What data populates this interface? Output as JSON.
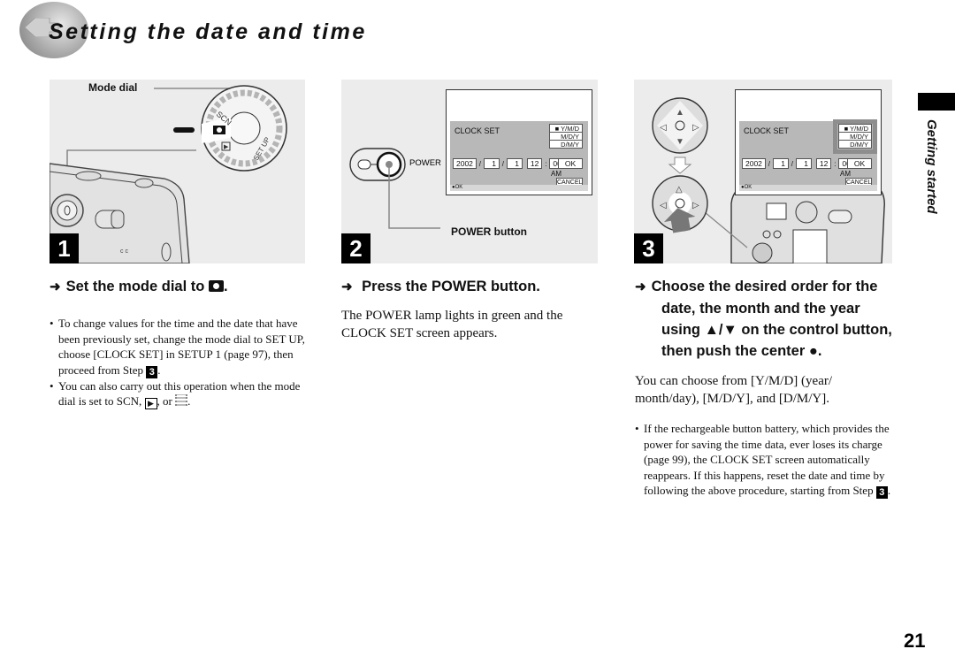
{
  "page": {
    "title": "Setting the date and time",
    "side_tab_label": "Getting started",
    "page_number": "21"
  },
  "step1": {
    "number": "1",
    "callout_label": "Mode dial",
    "dial_labels": {
      "scn": "SCN",
      "setup": "SET UP"
    },
    "heading": "Set the mode dial to",
    "heading_icon": "camera-icon",
    "bullets": [
      {
        "text_before": "To change values for the time and the date that have been previously set, change the mode dial to SET UP, choose [CLOCK SET] in SETUP 1 (page 97), then proceed from Step",
        "step_ref": "3",
        "text_after": "."
      },
      {
        "text_before": "You can also carry out this operation when the mode dial is set to SCN,",
        "icon1": "play-icon",
        "middle": ", or",
        "icon2": "movie-icon",
        "text_after": "."
      }
    ]
  },
  "step2": {
    "number": "2",
    "power_label": "POWER",
    "callout_label": "POWER button",
    "heading": "Press the POWER button.",
    "body": "The POWER lamp lights in green and the CLOCK SET screen appears."
  },
  "step3": {
    "number": "3",
    "heading": "Choose the desired order for the date, the month and the year using ▲/▼ on the control button, then push the center ●.",
    "body": "You can choose from [Y/M/D] (year/ month/day), [M/D/Y], and [D/M/Y].",
    "bullet_before": "If the rechargeable button battery, which provides the power for saving the time data, ever loses its charge (page 99), the CLOCK SET screen automatically reappears. If this happens, reset the date and time by following the above procedure, starting from Step",
    "bullet_ref": "3",
    "bullet_after": "."
  },
  "clock_screen": {
    "title": "CLOCK SET",
    "options": [
      "Y/M/D",
      "M/D/Y",
      "D/M/Y"
    ],
    "selected_option": "Y/M/D",
    "year": "2002",
    "month": "1",
    "day": "1",
    "hour": "12",
    "minute": "00",
    "ampm": "AM",
    "ok_label": "OK",
    "cancel_label": "CANCEL",
    "footer": "●OK"
  }
}
